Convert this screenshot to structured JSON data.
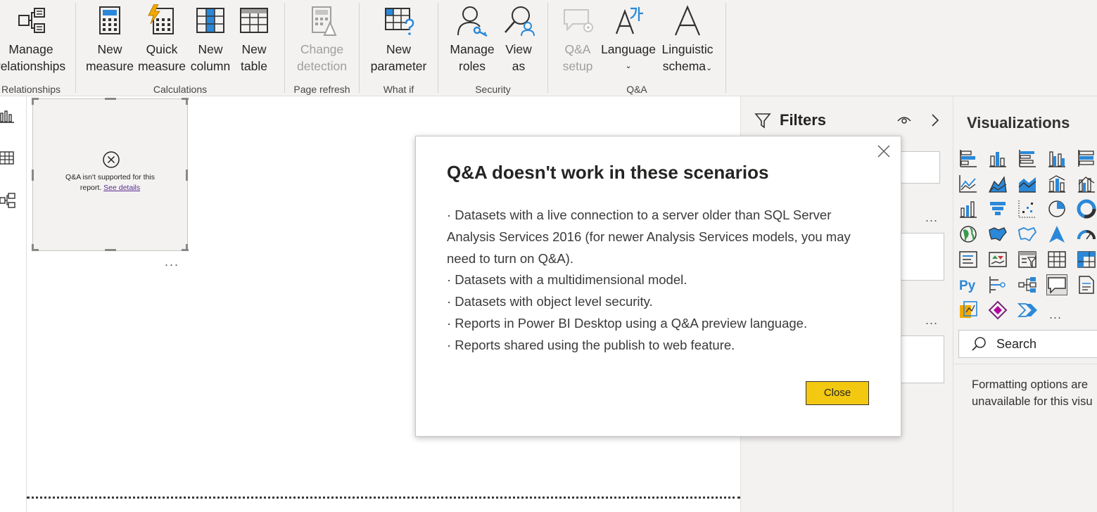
{
  "ribbon": {
    "groups": [
      {
        "label": "Relationships",
        "buttons": [
          {
            "line1": "Manage",
            "line2": "relationships",
            "icon": "manage-relationships-icon"
          }
        ]
      },
      {
        "label": "Calculations",
        "buttons": [
          {
            "line1": "New",
            "line2": "measure",
            "icon": "new-measure-icon"
          },
          {
            "line1": "Quick",
            "line2": "measure",
            "icon": "quick-measure-icon"
          },
          {
            "line1": "New",
            "line2": "column",
            "icon": "new-column-icon"
          },
          {
            "line1": "New",
            "line2": "table",
            "icon": "new-table-icon"
          }
        ]
      },
      {
        "label": "Page refresh",
        "buttons": [
          {
            "line1": "Change",
            "line2": "detection",
            "icon": "change-detection-icon",
            "disabled": true
          }
        ]
      },
      {
        "label": "What if",
        "buttons": [
          {
            "line1": "New",
            "line2": "parameter",
            "icon": "new-parameter-icon"
          }
        ]
      },
      {
        "label": "Security",
        "buttons": [
          {
            "line1": "Manage",
            "line2": "roles",
            "icon": "manage-roles-icon"
          },
          {
            "line1": "View",
            "line2": "as",
            "icon": "view-as-icon"
          }
        ]
      },
      {
        "label": "Q&A",
        "buttons": [
          {
            "line1": "Q&A",
            "line2": "setup",
            "icon": "qa-setup-icon",
            "disabled": true
          },
          {
            "line1": "Language",
            "line2": "⌄",
            "icon": "language-icon"
          },
          {
            "line1": "Linguistic",
            "line2": "schema",
            "line2_suffix": "⌄",
            "icon": "linguistic-schema-icon"
          }
        ]
      }
    ]
  },
  "visual": {
    "message_line1": "Q&A isn't supported for this",
    "message_line2_prefix": "report.",
    "see_details": "See details",
    "more": "..."
  },
  "filters": {
    "title": "Filters",
    "more1": "...",
    "more2": "..."
  },
  "visualizations": {
    "title": "Visualizations",
    "search_label": "Search",
    "format_line1": "Formatting options are",
    "format_line2": "unavailable for this visu",
    "more": "..."
  },
  "dialog": {
    "title": "Q&A doesn't work in these scenarios",
    "lines": [
      "· Datasets with a live connection to a server older than SQL Server",
      "Analysis Services 2016 (for newer Analysis Services models, you may",
      "need to turn on Q&A).",
      "· Datasets with a multidimensional model.",
      "· Datasets with object level security.",
      "· Reports in Power BI Desktop using a Q&A preview language.",
      "· Reports shared using the publish to web feature."
    ],
    "close_button": "Close"
  },
  "colors": {
    "accent_yellow": "#f2c811",
    "icon_blue": "#2b88d8",
    "icon_dark": "#323130",
    "link_purple": "#5c2d91"
  }
}
